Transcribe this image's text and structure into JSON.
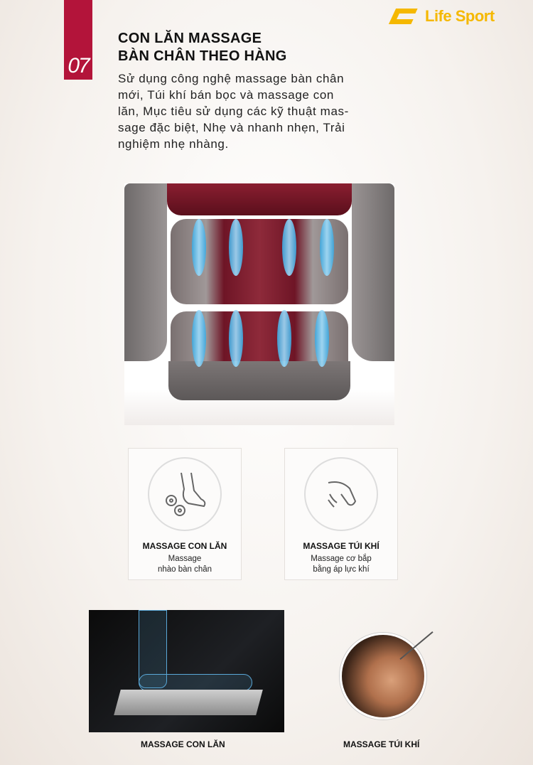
{
  "section_number": "07",
  "brand": {
    "name": "Life Sport",
    "color": "#f5b800"
  },
  "accent_color": "#b3143a",
  "title_lines": [
    "CON LĂN  MASSAGE",
    "BÀN CHÂN  THEO  HÀNG"
  ],
  "body_lines": [
    "Sử dụng công nghệ massage bàn chân",
    "mới, Túi khí bán bọc và massage con",
    "lăn, Mục tiêu sử dụng các kỹ thuật mas-",
    "sage đặc biệt, Nhẹ và nhanh nhẹn, Trải",
    "nghiệm nhẹ nhàng."
  ],
  "features": [
    {
      "icon": "foot-roller-icon",
      "title": "MASSAGE CON LĂN",
      "desc_lines": [
        "Massage",
        "nhào bàn chân"
      ]
    },
    {
      "icon": "hand-air-icon",
      "title": "MASSAGE TÚI KHÍ",
      "desc_lines": [
        "Massage cơ bắp",
        "bằng áp lực khí"
      ]
    }
  ],
  "captions": {
    "roller": "MASSAGE CON LĂN",
    "airbag": "MASSAGE TÚI KHÍ"
  }
}
